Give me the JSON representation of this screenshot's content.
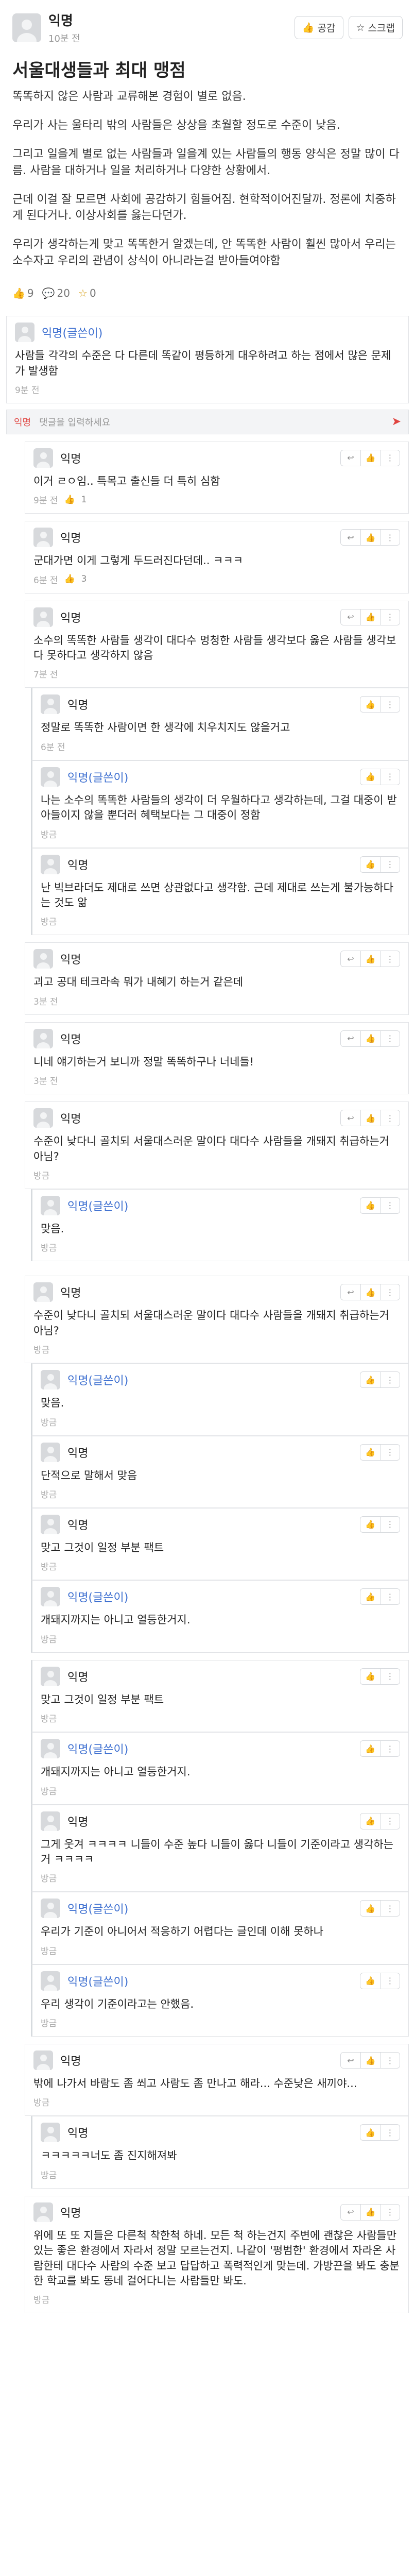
{
  "post": {
    "author": "익명",
    "time": "10분 전",
    "like_label": "공감",
    "scrap_label": "스크랩",
    "title": "서울대생들과 최대 맹점",
    "body": [
      "똑똑하지 않은 사람과 교류해본 경험이 별로 없음.",
      "우리가 사는 울타리 밖의 사람들은 상상을 초월할 정도로 수준이 낮음.",
      "그리고 일을계 별로 없는 사람들과 일을계 있는 사람들의 행동 양식은 정말 많이 다름. 사람을 대하거나 일을 처리하거나 다양한 상황에서.",
      "근데 이걸 잘 모르면 사회에 공감하기 힘들어짐. 현학적이어진달까. 정론에 치중하게 된다거나. 이상사회를 옳는다던가.",
      "우리가 생각하는게 맞고 똑똑한거 알겠는데, 안 똑똑한 사람이 훨씬 많아서 우리는 소수자고 우리의 관념이 상식이 아니라는걸 받아들여야함"
    ],
    "likes": "9",
    "comments": "20",
    "scraps": "0"
  },
  "comment_input": {
    "nick": "익명",
    "placeholder": "댓글을 입력하세요"
  },
  "comments": [
    {
      "name": "익명(글쓴이)",
      "op": true,
      "text": "사람들 각각의 수준은 다 다른데 똑같이 평등하게 대우하려고 하는 점에서 많은 문제가 발생함",
      "time": "9분 전"
    },
    {
      "name": "익명",
      "op": false,
      "text": "이거 ㄹㅇ임.. 특목고 출신들 더 특히 심함",
      "time": "9분 전",
      "likes": "1"
    },
    {
      "name": "익명",
      "op": false,
      "text": "군대가면 이게 그렇게 두드러진다던데.. ㅋㅋㅋ",
      "time": "6분 전",
      "likes": "3"
    },
    {
      "name": "익명",
      "op": false,
      "text": "소수의 똑똑한 사람들 생각이 대다수 멍청한 사람들 생각보다 옳은 사람들 생각보다 못하다고 생각하지 않음",
      "time": "7분 전"
    },
    {
      "name": "익명",
      "op": false,
      "text": "정말로 똑똑한 사람이면 한 생각에 치우치지도 않을거고",
      "time": "6분 전"
    },
    {
      "name": "익명(글쓴이)",
      "op": true,
      "text": "나는 소수의 똑똑한 사람들의 생각이 더 우월하다고 생각하는데, 그걸 대중이 받아들이지 않을 뿐더러 혜택보다는 그 대중이 정함",
      "time": "방금"
    },
    {
      "name": "익명",
      "op": false,
      "text": "난 빅브라더도 제대로 쓰면 상관없다고 생각함. 근데 제대로 쓰는게 불가능하다는 것도 앎",
      "time": "방금"
    },
    {
      "name": "익명",
      "op": false,
      "text": "괴고 공대 테크라속 뭐가 내혜기 하는거 같은데",
      "time": "3분 전"
    },
    {
      "name": "익명",
      "op": false,
      "text": "니네 얘기하는거 보니까 정말 똑똑하구나 너네들!",
      "time": "3분 전"
    },
    {
      "name": "익명",
      "op": false,
      "text": "수준이 낮다니 골치되 서울대스러운 말이다 대다수 사람들을 개돼지 취급하는거 아님?",
      "time": "방금"
    },
    {
      "name": "익명(글쓴이)",
      "op": true,
      "text": "맞음.",
      "time": "방금"
    },
    {
      "name": "익명",
      "op": false,
      "text": "수준이 낮다니 골치되 서울대스러운 말이다 대다수 사람들을 개돼지 취급하는거 아님?",
      "time": "방금"
    },
    {
      "name": "익명(글쓴이)",
      "op": true,
      "text": "맞음.",
      "time": "방금"
    },
    {
      "name": "익명",
      "op": false,
      "text": "단적으로 말해서 맞음",
      "time": "방금"
    },
    {
      "name": "익명",
      "op": false,
      "text": "맞고 그것이 일정 부분 팩트",
      "time": "방금"
    },
    {
      "name": "익명(글쓴이)",
      "op": true,
      "text": "개돼지까지는 아니고 열등한거지.",
      "time": "방금"
    },
    {
      "name": "익명",
      "op": false,
      "text": "맞고 그것이 일정 부분 팩트",
      "time": "방금"
    },
    {
      "name": "익명(글쓴이)",
      "op": true,
      "text": "개돼지까지는 아니고 열등한거지.",
      "time": "방금"
    },
    {
      "name": "익명",
      "op": false,
      "text": "그게 웃겨 ㅋㅋㅋㅋ 니들이 수준 높다 니들이 옳다 니들이 기준이라고 생각하는거 ㅋㅋㅋㅋ",
      "time": "방금"
    },
    {
      "name": "익명(글쓴이)",
      "op": true,
      "text": "우리가 기준이 아니어서 적응하기 어렵다는 글인데 이해 못하나",
      "time": "방금"
    },
    {
      "name": "익명(글쓴이)",
      "op": true,
      "text": "우리 생각이 기준이라고는 안했음.",
      "time": "방금"
    },
    {
      "name": "익명",
      "op": false,
      "text": "밖에 나가서 바람도 좀 쐬고 사람도 좀 만나고 해라... 수준낮은 새끼야...",
      "time": "방금"
    },
    {
      "name": "익명",
      "op": false,
      "text": "ㅋㅋㅋㅋㅋ너도 좀 진지해져봐",
      "time": "방금"
    },
    {
      "name": "익명",
      "op": false,
      "text": "위에 또 또 지들은 다른척 착한척 하네. 모든 척 하는건지 주변에 괜찮은 사람들만 있는 좋은 환경에서 자라서 정말 모르는건지. 나같이 '평범한' 환경에서 자라온 사람한테 대다수 사람의 수준 보고 답답하고 폭력적인게 맞는데. 가방끈을 봐도 충분한 학교를 봐도 동네 걸어다니는 사람들만 봐도.",
      "time": "방금"
    }
  ]
}
